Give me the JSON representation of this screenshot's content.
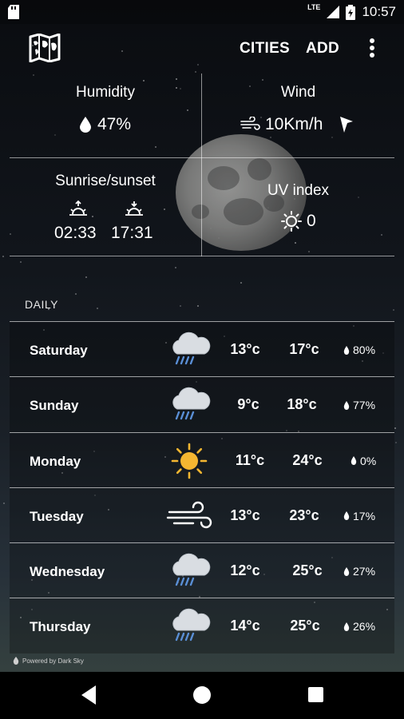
{
  "status_bar": {
    "network": "LTE",
    "time": "10:57"
  },
  "app_bar": {
    "cities_label": "CITIES",
    "add_label": "ADD",
    "map_icon": "map-icon",
    "more_icon": "more-vert-icon"
  },
  "current": {
    "humidity_label": "Humidity",
    "humidity_value": "47%",
    "wind_label": "Wind",
    "wind_value": "10Km/h",
    "sunrise_label": "Sunrise/sunset",
    "sunrise_time": "02:33",
    "sunset_time": "17:31",
    "uv_label": "UV index",
    "uv_value": "0"
  },
  "daily": {
    "label": "DAILY",
    "days": [
      {
        "name": "Saturday",
        "icon": "rain",
        "min": "13°c",
        "max": "17°c",
        "rain": "80%"
      },
      {
        "name": "Sunday",
        "icon": "rain",
        "min": "9°c",
        "max": "18°c",
        "rain": "77%"
      },
      {
        "name": "Monday",
        "icon": "sun",
        "min": "11°c",
        "max": "24°c",
        "rain": "0%"
      },
      {
        "name": "Tuesday",
        "icon": "wind",
        "min": "13°c",
        "max": "23°c",
        "rain": "17%"
      },
      {
        "name": "Wednesday",
        "icon": "rain",
        "min": "12°c",
        "max": "25°c",
        "rain": "27%"
      },
      {
        "name": "Thursday",
        "icon": "rain",
        "min": "14°c",
        "max": "25°c",
        "rain": "26%"
      }
    ]
  },
  "footer": {
    "powered_by": "Powered by Dark Sky"
  },
  "colors": {
    "sun": "#f5b731",
    "rain_drops": "#5a8fd6",
    "cloud": "#d9dde2"
  }
}
